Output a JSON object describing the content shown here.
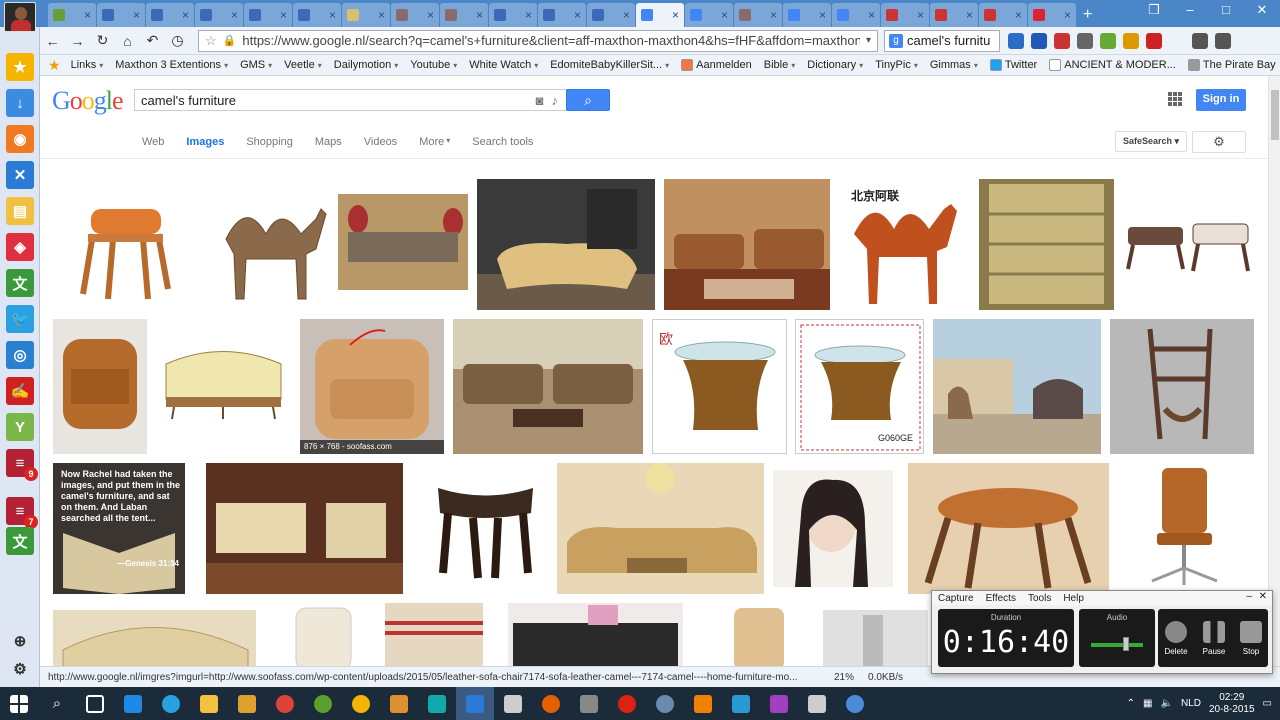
{
  "browser": {
    "url": "https://www.google.nl/search?q=camel's+furniture&client=aff-maxthon-maxthon4&hs=fHF&affdom=maxthon.c",
    "search_text": "camel's furnitu",
    "tab_count": 21
  },
  "bookmarks": [
    {
      "label": "Links",
      "dropdown": true
    },
    {
      "label": "Maxthon 3 Extentions",
      "dropdown": true
    },
    {
      "label": "GMS",
      "dropdown": true
    },
    {
      "label": "Veetle",
      "dropdown": true
    },
    {
      "label": "Dailymotion",
      "dropdown": true
    },
    {
      "label": "Youtube",
      "dropdown": true
    },
    {
      "label": "White Watch",
      "dropdown": true
    },
    {
      "label": "EdomiteBabyKillerSit...",
      "dropdown": true
    },
    {
      "label": "Aanmelden",
      "dropdown": false
    },
    {
      "label": "Bible",
      "dropdown": true
    },
    {
      "label": "Dictionary",
      "dropdown": true
    },
    {
      "label": "TinyPic",
      "dropdown": true
    },
    {
      "label": "Gimmas",
      "dropdown": true
    },
    {
      "label": "Twitter",
      "dropdown": false
    },
    {
      "label": "ANCIENT & MODER...",
      "dropdown": false
    },
    {
      "label": "The Pirate Bay",
      "dropdown": false
    }
  ],
  "sidebar": {
    "badges": [
      "9",
      "7"
    ]
  },
  "google": {
    "logo": "Google",
    "query": "camel's furniture",
    "signin": "Sign in",
    "tabs": [
      "Web",
      "Images",
      "Shopping",
      "Maps",
      "Videos",
      "More",
      "Search tools"
    ],
    "active_tab": "Images",
    "safesearch": "SafeSearch"
  },
  "images": {
    "hover_caption": "876 × 768 - soofass.com",
    "bible_text": "Now Rachel had taken the images, and put them in the camel's furniture, and sat on them. And Laban searched all the tent...",
    "bible_ref": "—Genesis 31:34",
    "stamp_text": "G060GE",
    "chinese_text": "北京阿联"
  },
  "statusbar": {
    "link": "http://www.google.nl/imgres?imgurl=http://www.soofass.com/wp-content/uploads/2015/05/leather-sofa-chair7174-sofa-leather-camel---7174-camel----home-furniture-mo...",
    "zoom": "21%",
    "speed": "0.0KB/s"
  },
  "capture": {
    "menu": [
      "Capture",
      "Effects",
      "Tools",
      "Help"
    ],
    "duration_label": "Duration",
    "duration": "0:16:40",
    "audio_label": "Audio",
    "delete": "Delete",
    "pause": "Pause",
    "stop": "Stop"
  },
  "taskbar": {
    "time": "02:29",
    "date": "20-8-2015",
    "lang": "NLD"
  }
}
